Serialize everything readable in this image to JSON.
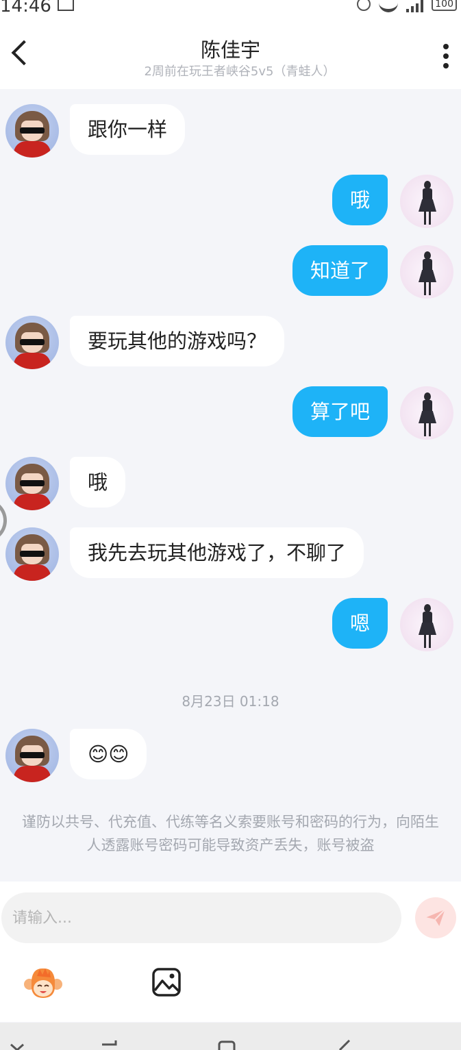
{
  "status_bar": {
    "time": "14:46",
    "battery": "100"
  },
  "header": {
    "title": "陈佳宇",
    "subtitle": "2周前在玩王者峡谷5v5（青蛙人）"
  },
  "messages": [
    {
      "side": "in",
      "text": "跟你一样"
    },
    {
      "side": "out",
      "text": "哦"
    },
    {
      "side": "out",
      "text": "知道了"
    },
    {
      "side": "in",
      "text": "要玩其他的游戏吗？"
    },
    {
      "side": "out",
      "text": "算了吧"
    },
    {
      "side": "in",
      "text": "哦"
    },
    {
      "side": "in",
      "text": "我先去玩其他游戏了，不聊了"
    },
    {
      "side": "out",
      "text": "嗯"
    },
    {
      "side": "in",
      "text": "😊😊"
    }
  ],
  "timestamp": "8月23日 01:18",
  "notice": "谨防以共号、代充值、代练等名义索要账号和密码的行为，向陌生人透露账号密码可能导致资产丢失，账号被盗",
  "input": {
    "placeholder": "请输入..."
  },
  "icons": {
    "back": "back-arrow-icon",
    "more": "more-vertical-icon",
    "send": "send-icon",
    "emoji": "monkey-emoji-icon",
    "image": "image-icon"
  },
  "colors": {
    "outgoing_bubble": "#1eb3f7",
    "background": "#f4f5f9",
    "send_button": "#fde4e2"
  }
}
